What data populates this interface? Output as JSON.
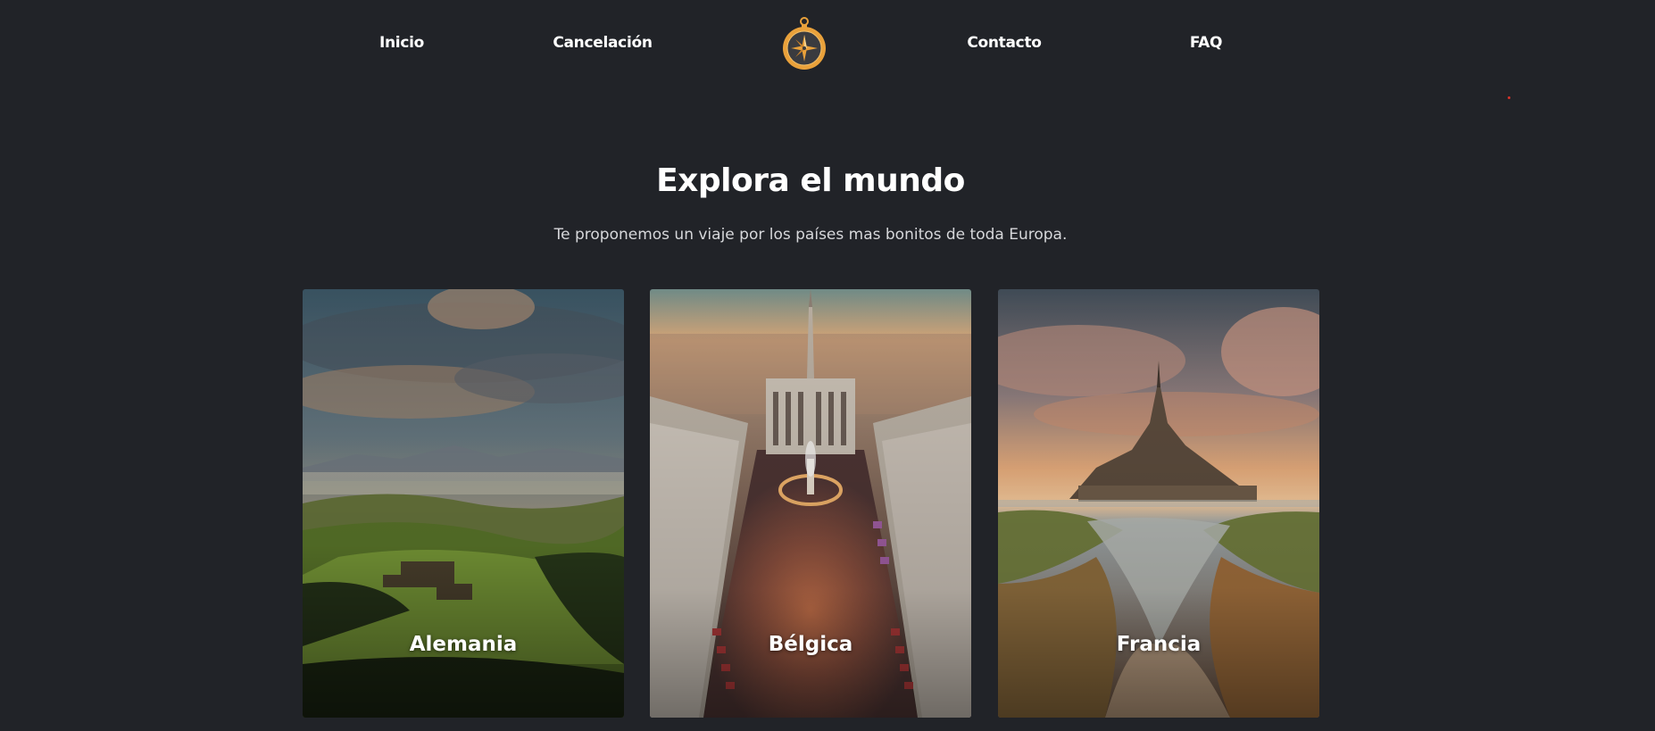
{
  "nav": {
    "items": [
      {
        "label": "Inicio"
      },
      {
        "label": "Cancelación"
      },
      {
        "label": "Contacto"
      },
      {
        "label": "FAQ"
      }
    ],
    "logo_icon": "compass-icon"
  },
  "hero": {
    "title": "Explora el mundo",
    "subtitle": "Te proponemos un viaje por los países mas bonitos de toda Europa."
  },
  "cards": [
    {
      "label": "Alemania",
      "image": "german-countryside-landscape"
    },
    {
      "label": "Bélgica",
      "image": "brussels-grand-place"
    },
    {
      "label": "Francia",
      "image": "mont-saint-michel"
    }
  ],
  "colors": {
    "background": "#212328",
    "text": "#ffffff",
    "accent": "#e9a13b",
    "dot": "#d8332a"
  }
}
